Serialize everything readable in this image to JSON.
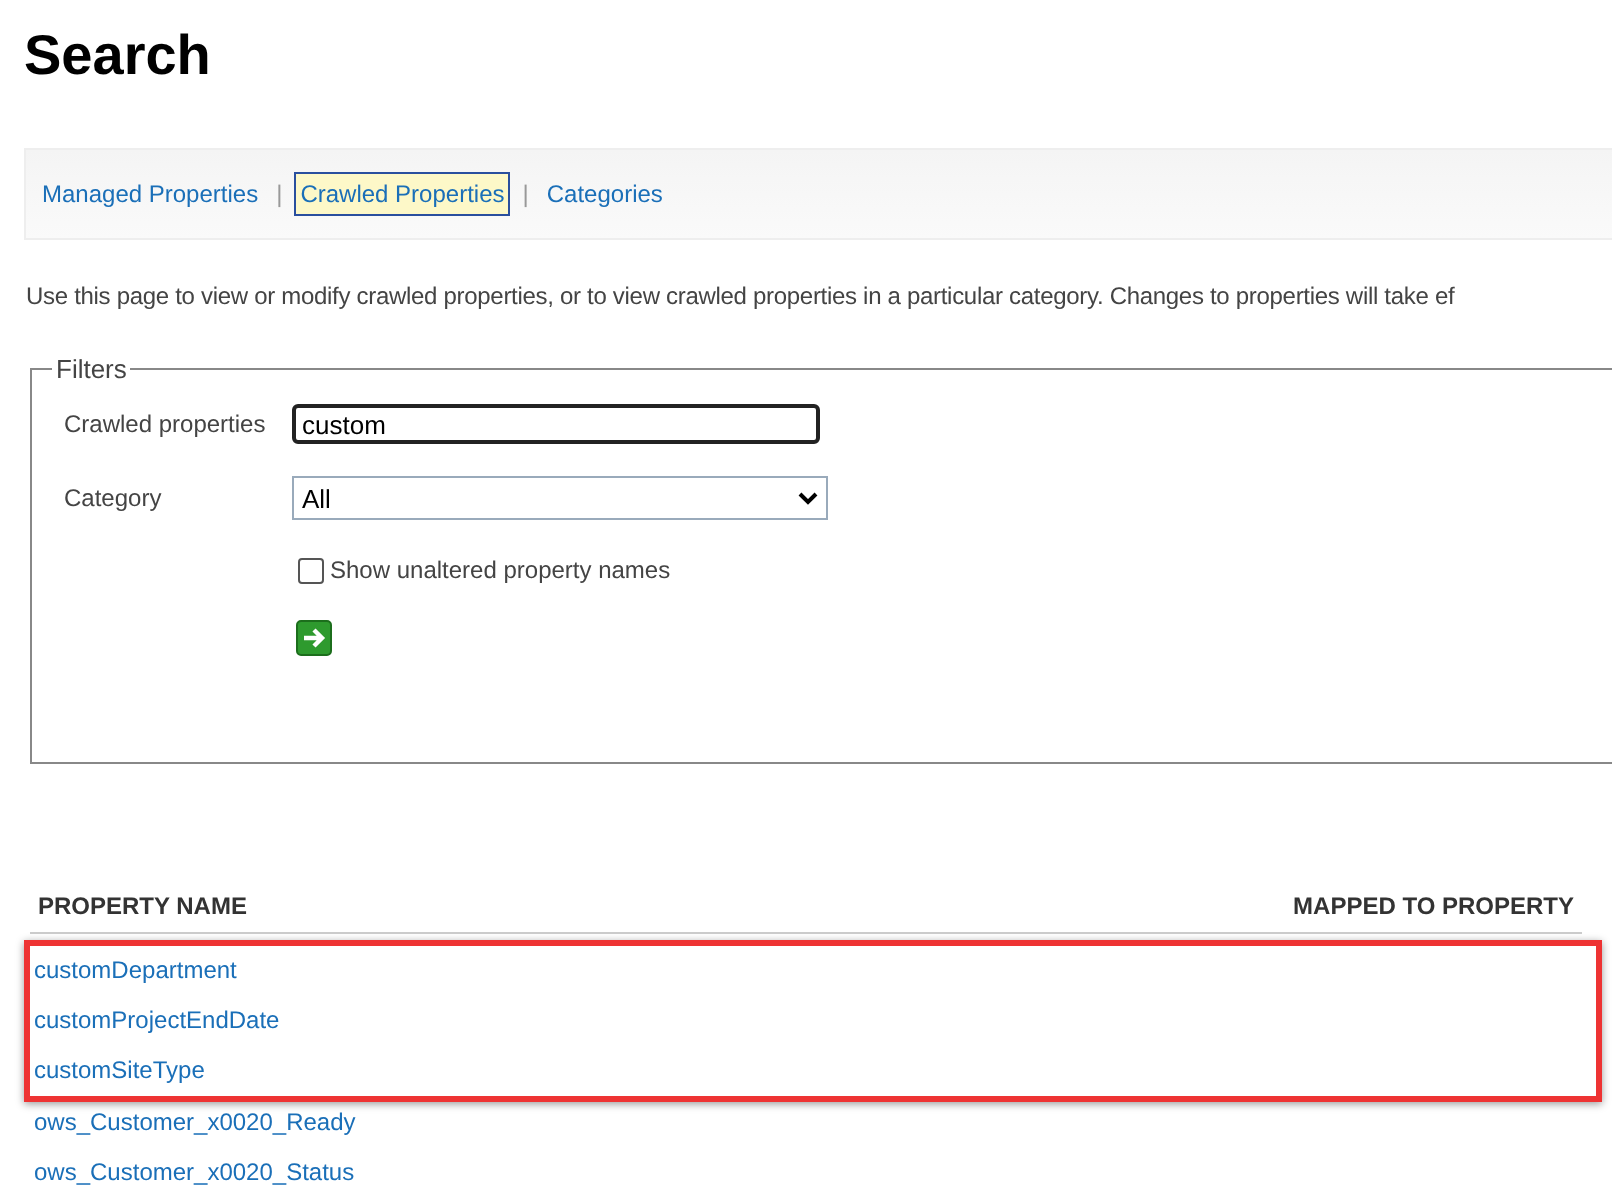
{
  "page_title": "Search",
  "nav": [
    {
      "label": "Managed Properties",
      "selected": false
    },
    {
      "label": "Crawled Properties",
      "selected": true
    },
    {
      "label": "Categories",
      "selected": false
    }
  ],
  "nav_separator": "|",
  "description": "Use this page to view or modify crawled properties, or to view crawled properties in a particular category. Changes to properties will take ef",
  "filters": {
    "legend": "Filters",
    "crawled_label": "Crawled properties",
    "crawled_value": "custom",
    "category_label": "Category",
    "category_value": "All",
    "unaltered_label": "Show unaltered property names",
    "unaltered_checked": false
  },
  "table": {
    "columns": [
      "PROPERTY NAME",
      "MAPPED TO PROPERTY"
    ],
    "rows": [
      {
        "name": "customDepartment",
        "highlighted": true
      },
      {
        "name": "customProjectEndDate",
        "highlighted": true
      },
      {
        "name": "customSiteType",
        "highlighted": true
      },
      {
        "name": "ows_Customer_x0020_Ready",
        "highlighted": false
      },
      {
        "name": "ows_Customer_x0020_Status",
        "highlighted": false
      }
    ]
  }
}
